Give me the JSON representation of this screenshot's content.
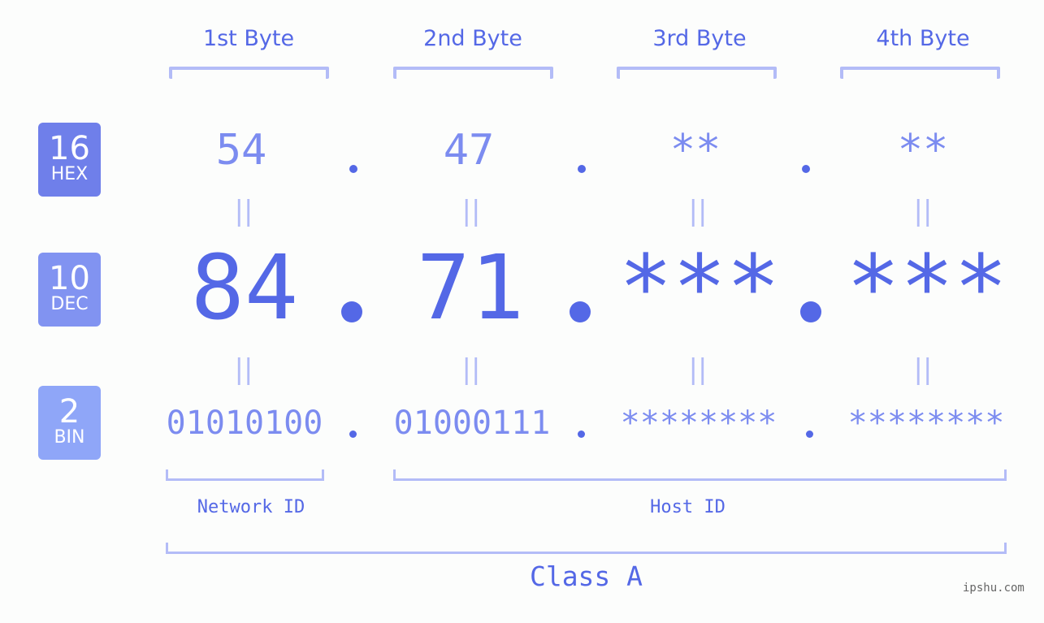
{
  "bytes": [
    {
      "header": "1st Byte",
      "hex": "54",
      "dec": "84",
      "bin": "01010100"
    },
    {
      "header": "2nd Byte",
      "hex": "47",
      "dec": "71",
      "bin": "01000111"
    },
    {
      "header": "3rd Byte",
      "hex": "**",
      "dec": "***",
      "bin": "********"
    },
    {
      "header": "4th Byte",
      "hex": "**",
      "dec": "***",
      "bin": "********"
    }
  ],
  "bases": {
    "hex": {
      "num": "16",
      "label": "HEX",
      "color": "#6f7fea"
    },
    "dec": {
      "num": "10",
      "label": "DEC",
      "color": "#8193f1"
    },
    "bin": {
      "num": "2",
      "label": "BIN",
      "color": "#8fa6f8"
    }
  },
  "equals_sign": "||",
  "network_id_label": "Network ID",
  "host_id_label": "Host ID",
  "class_label": "Class A",
  "watermark": "ipshu.com",
  "colors": {
    "primary": "#5468e6",
    "light": "#7c8cf0",
    "bracket": "#b3bcf7"
  }
}
